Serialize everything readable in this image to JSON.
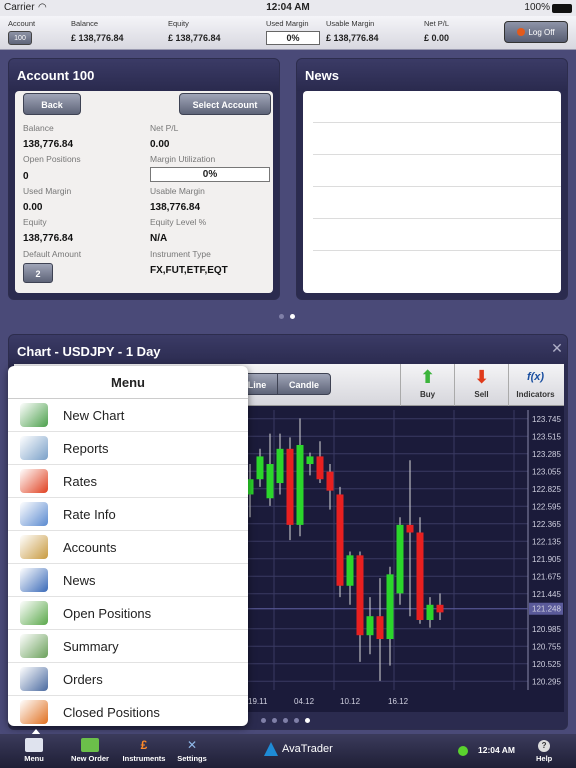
{
  "status": {
    "carrier": "Carrier",
    "time": "12:04 AM",
    "battery": "100%"
  },
  "account_bar": {
    "account_label": "Account",
    "account_value": "100",
    "balance_label": "Balance",
    "balance_value": "£ 138,776.84",
    "equity_label": "Equity",
    "equity_value": "£ 138,776.84",
    "used_margin_label": "Used Margin",
    "used_margin_value": "0%",
    "usable_margin_label": "Usable Margin",
    "usable_margin_value": "£ 138,776.84",
    "net_pl_label": "Net P/L",
    "net_pl_value": "£ 0.00",
    "logoff_label": "Log Off"
  },
  "account_panel": {
    "title": "Account 100",
    "back_label": "Back",
    "select_label": "Select Account",
    "balance_label": "Balance",
    "balance_value": "138,776.84",
    "netpl_label": "Net P/L",
    "netpl_value": "0.00",
    "open_positions_label": "Open Positions",
    "open_positions_value": "0",
    "margin_util_label": "Margin Utilization",
    "margin_util_value": "0%",
    "used_margin_label": "Used Margin",
    "used_margin_value": "0.00",
    "usable_margin_label": "Usable Margin",
    "usable_margin_value": "138,776.84",
    "equity_label": "Equity",
    "equity_value": "138,776.84",
    "equity_level_label": "Equity Level %",
    "equity_level_value": "N/A",
    "default_amount_label": "Default Amount",
    "default_amount_value": "2",
    "instrument_type_label": "Instrument Type",
    "instrument_type_value": "FX,FUT,ETF,EQT"
  },
  "news_panel": {
    "title": "News"
  },
  "chart_panel": {
    "title": "Chart - USDJPY - 1 Day",
    "close_glyph": "✕",
    "line_label": "Line",
    "candle_label": "Candle",
    "buy_label": "Buy",
    "sell_label": "Sell",
    "indicators_label": "Indicators",
    "fx_glyph": "f(x)"
  },
  "chart_data": {
    "type": "candlestick",
    "y_ticks": [
      "123.745",
      "123.515",
      "123.285",
      "123.055",
      "122.825",
      "122.595",
      "122.365",
      "122.135",
      "121.905",
      "121.675",
      "121.445",
      "121.248",
      "120.985",
      "120.755",
      "120.525",
      "120.295"
    ],
    "ylim": [
      120.18,
      123.86
    ],
    "current_price": "121.248",
    "x_ticks": [
      "19.11",
      "04.12",
      "10.12",
      "16.12"
    ],
    "candles": [
      {
        "o": 122.75,
        "h": 123.15,
        "l": 122.45,
        "c": 122.95
      },
      {
        "o": 122.95,
        "h": 123.35,
        "l": 122.85,
        "c": 123.25
      },
      {
        "o": 122.7,
        "h": 123.55,
        "l": 122.6,
        "c": 123.15
      },
      {
        "o": 122.9,
        "h": 123.55,
        "l": 122.75,
        "c": 123.35
      },
      {
        "o": 123.35,
        "h": 123.5,
        "l": 122.15,
        "c": 122.35
      },
      {
        "o": 122.35,
        "h": 123.75,
        "l": 122.2,
        "c": 123.4
      },
      {
        "o": 123.15,
        "h": 123.3,
        "l": 123.0,
        "c": 123.25
      },
      {
        "o": 123.25,
        "h": 123.45,
        "l": 122.9,
        "c": 122.95
      },
      {
        "o": 123.05,
        "h": 123.15,
        "l": 122.55,
        "c": 122.8
      },
      {
        "o": 122.75,
        "h": 122.85,
        "l": 121.4,
        "c": 121.55
      },
      {
        "o": 121.55,
        "h": 122.0,
        "l": 121.3,
        "c": 121.95
      },
      {
        "o": 121.95,
        "h": 122.0,
        "l": 120.55,
        "c": 120.9
      },
      {
        "o": 120.9,
        "h": 121.4,
        "l": 120.65,
        "c": 121.15
      },
      {
        "o": 121.15,
        "h": 121.65,
        "l": 120.3,
        "c": 120.85
      },
      {
        "o": 120.85,
        "h": 121.8,
        "l": 120.5,
        "c": 121.7
      },
      {
        "o": 121.45,
        "h": 122.45,
        "l": 121.3,
        "c": 122.35
      },
      {
        "o": 122.35,
        "h": 123.2,
        "l": 121.15,
        "c": 122.25
      },
      {
        "o": 122.25,
        "h": 122.45,
        "l": 121.05,
        "c": 121.1
      },
      {
        "o": 121.1,
        "h": 121.4,
        "l": 121.0,
        "c": 121.3
      },
      {
        "o": 121.3,
        "h": 121.45,
        "l": 121.1,
        "c": 121.2
      }
    ],
    "up_color": "#2bd62b",
    "down_color": "#e82020",
    "grid": true
  },
  "menu": {
    "title": "Menu",
    "items": [
      {
        "label": "New Chart",
        "icon": "new-chart-icon"
      },
      {
        "label": "Reports",
        "icon": "reports-icon"
      },
      {
        "label": "Rates",
        "icon": "rates-icon"
      },
      {
        "label": "Rate Info",
        "icon": "rate-info-icon"
      },
      {
        "label": "Accounts",
        "icon": "accounts-icon"
      },
      {
        "label": "News",
        "icon": "news-icon"
      },
      {
        "label": "Open Positions",
        "icon": "open-positions-icon"
      },
      {
        "label": "Summary",
        "icon": "summary-icon"
      },
      {
        "label": "Orders",
        "icon": "orders-icon"
      },
      {
        "label": "Closed Positions",
        "icon": "closed-positions-icon"
      }
    ]
  },
  "tabbar": {
    "menu_label": "Menu",
    "new_order_label": "New Order",
    "instruments_label": "Instruments",
    "settings_label": "Settings",
    "brand": "AvaTrader",
    "time": "12:04 AM",
    "help_label": "Help",
    "help_glyph": "?"
  }
}
